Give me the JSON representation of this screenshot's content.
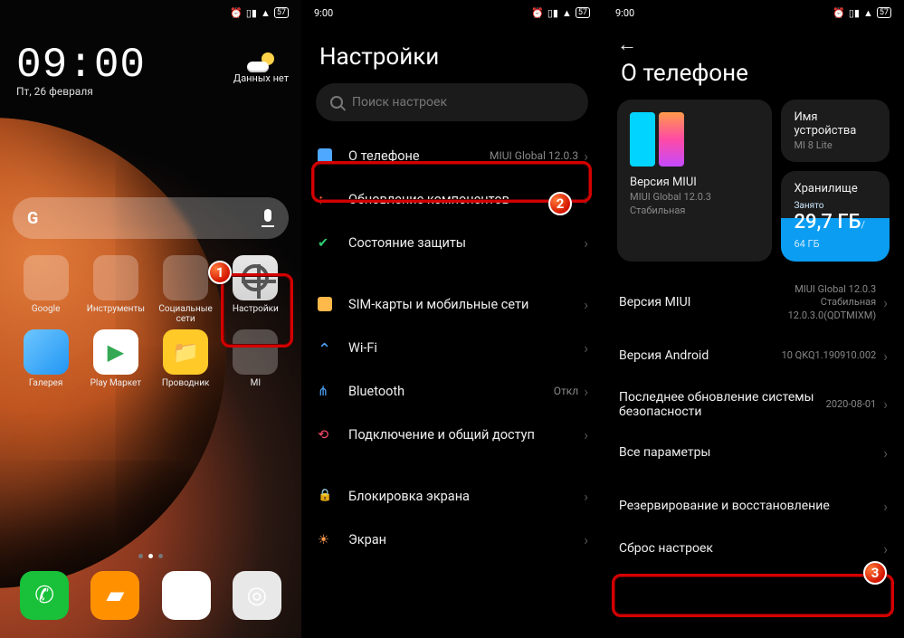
{
  "status": {
    "time": "9:00",
    "battery": "57"
  },
  "home": {
    "time": "09:00",
    "date": "Пт, 26 февраля",
    "weather_label": "Данных нет",
    "search_hint": "G",
    "apps": [
      {
        "label": "Google",
        "type": "folder",
        "colors": [
          "#ea4335",
          "#34a853",
          "#fbbc05",
          "#4285f4",
          "#ff6d00",
          "#00acc1",
          "#ab47bc",
          "#26a69a",
          "#8d6e63"
        ]
      },
      {
        "label": "Инструменты",
        "type": "folder",
        "colors": [
          "#4fc3f7",
          "#ffca28",
          "#ff7043",
          "#4db6ac",
          "#7e57c2",
          "#ec407a",
          "#26c6da",
          "#9ccc65",
          "#ffa726"
        ]
      },
      {
        "label": "Социальные сети",
        "type": "folder-sm",
        "colors": [
          "#1877f2",
          "#ff0050",
          "#229ed9"
        ]
      },
      {
        "label": "Настройки",
        "type": "settings"
      },
      {
        "label": "Галерея",
        "type": "single",
        "bg": "linear-gradient(135deg,#6ec6ff,#2196f3)"
      },
      {
        "label": "Play Маркет",
        "type": "single",
        "bg": "#fff",
        "glyph": "▶",
        "glyphColor": "#34a853"
      },
      {
        "label": "Проводник",
        "type": "single",
        "bg": "#ffca28",
        "glyph": "📁"
      },
      {
        "label": "MI",
        "type": "folder",
        "colors": [
          "#ff6f00",
          "#42a5f5",
          "#66bb6a",
          "#ef5350",
          "#ab47bc",
          "#26c6da",
          "#ffee58",
          "#8d6e63",
          "#78909c"
        ]
      }
    ],
    "dock": [
      {
        "name": "phone",
        "bg": "#18c139",
        "glyph": "✆"
      },
      {
        "name": "messages",
        "bg": "#ff9100",
        "glyph": "▰"
      },
      {
        "name": "chrome",
        "bg": "#fff",
        "glyph": "◉"
      },
      {
        "name": "camera",
        "bg": "#e8e8e8",
        "glyph": "◎"
      }
    ]
  },
  "settings": {
    "title": "Настройки",
    "search_placeholder": "Поиск настроек",
    "section1": [
      {
        "icon": "about",
        "color": "#4fa8ff",
        "label": "О телефоне",
        "sub": "MIUI Global 12.0.3"
      },
      {
        "icon": "update",
        "color": "#ff6d3a",
        "label": "Обновление компонентов",
        "sub": ""
      },
      {
        "icon": "shield",
        "color": "#2ecc71",
        "label": "Состояние защиты",
        "sub": ""
      }
    ],
    "section2": [
      {
        "icon": "sim",
        "color": "#ffb84a",
        "label": "SIM-карты и мобильные сети"
      },
      {
        "icon": "wifi",
        "color": "#4fa8ff",
        "label": "Wi-Fi",
        "sub": ""
      },
      {
        "icon": "bt",
        "color": "#4fa8ff",
        "label": "Bluetooth",
        "sub": "Откл"
      },
      {
        "icon": "share",
        "color": "#ff4a6b",
        "label": "Подключение и общий доступ"
      }
    ],
    "section3": [
      {
        "icon": "lock",
        "color": "#2ecc71",
        "label": "Блокировка экрана"
      },
      {
        "icon": "display",
        "color": "#ff9a4a",
        "label": "Экран"
      }
    ]
  },
  "about": {
    "title": "О телефоне",
    "miui_version_label": "Версия MIUI",
    "miui_version_value": "MIUI Global 12.0.3",
    "miui_stability": "Стабильная",
    "device_name_label": "Имя устройства",
    "device_name_value": "MI 8 Lite",
    "storage_label": "Хранилище",
    "storage_busy": "Занято",
    "storage_used": "29,7 ГБ",
    "storage_total": "/ 64 ГБ",
    "rows": [
      {
        "label": "Версия MIUI",
        "value": "MIUI Global 12.0.3\nСтабильная\n12.0.3.0(QDTMIXM)"
      },
      {
        "label": "Версия Android",
        "value": "10 QKQ1.190910.002"
      },
      {
        "label": "Последнее обновление системы безопасности",
        "value": "2020-08-01"
      },
      {
        "label": "Все параметры",
        "value": ""
      },
      {
        "label": "Резервирование и восстановление",
        "value": ""
      },
      {
        "label": "Сброс настроек",
        "value": ""
      }
    ]
  },
  "badges": {
    "b1": "1",
    "b2": "2",
    "b3": "3"
  }
}
